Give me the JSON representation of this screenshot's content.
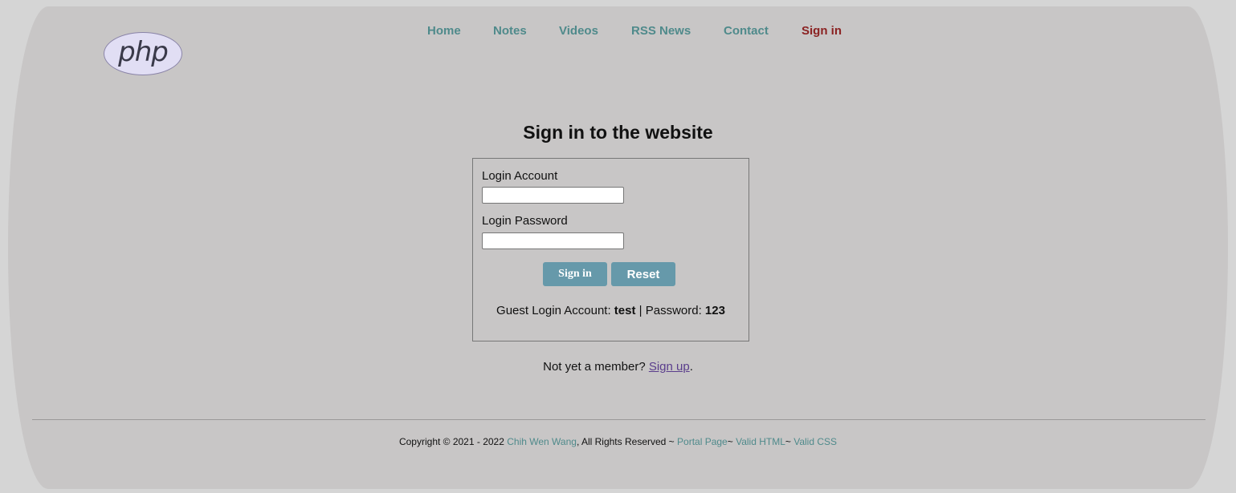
{
  "logo": {
    "text": "php"
  },
  "nav": {
    "items": [
      {
        "label": "Home",
        "active": false
      },
      {
        "label": "Notes",
        "active": false
      },
      {
        "label": "Videos",
        "active": false
      },
      {
        "label": "RSS News",
        "active": false
      },
      {
        "label": "Contact",
        "active": false
      },
      {
        "label": "Sign in",
        "active": true
      }
    ]
  },
  "main": {
    "title": "Sign in to the website",
    "form": {
      "account_label": "Login Account",
      "account_value": "",
      "password_label": "Login Password",
      "password_value": "",
      "signin_button": "Sign in",
      "reset_button": "Reset"
    },
    "guest": {
      "prefix": "Guest Login Account: ",
      "account": "test",
      "separator": " | Password: ",
      "password": "123"
    },
    "member": {
      "prefix": "Not yet a member? ",
      "link": "Sign up",
      "suffix": "."
    }
  },
  "footer": {
    "copyright": "Copyright © 2021 - 2022 ",
    "author": "Chih Wen Wang",
    "rights": ", All Rights Reserved ~ ",
    "portal": "Portal Page",
    "sep1": "~ ",
    "valid_html": "Valid HTML",
    "sep2": "~ ",
    "valid_css": "Valid CSS"
  },
  "colors": {
    "page_background": "#c8c6c6",
    "outer_background": "#d5d5d5",
    "nav_link": "#4f8a8b",
    "nav_active": "#8b2222",
    "button": "#6699aa",
    "visited_link": "#5a3d8c"
  }
}
